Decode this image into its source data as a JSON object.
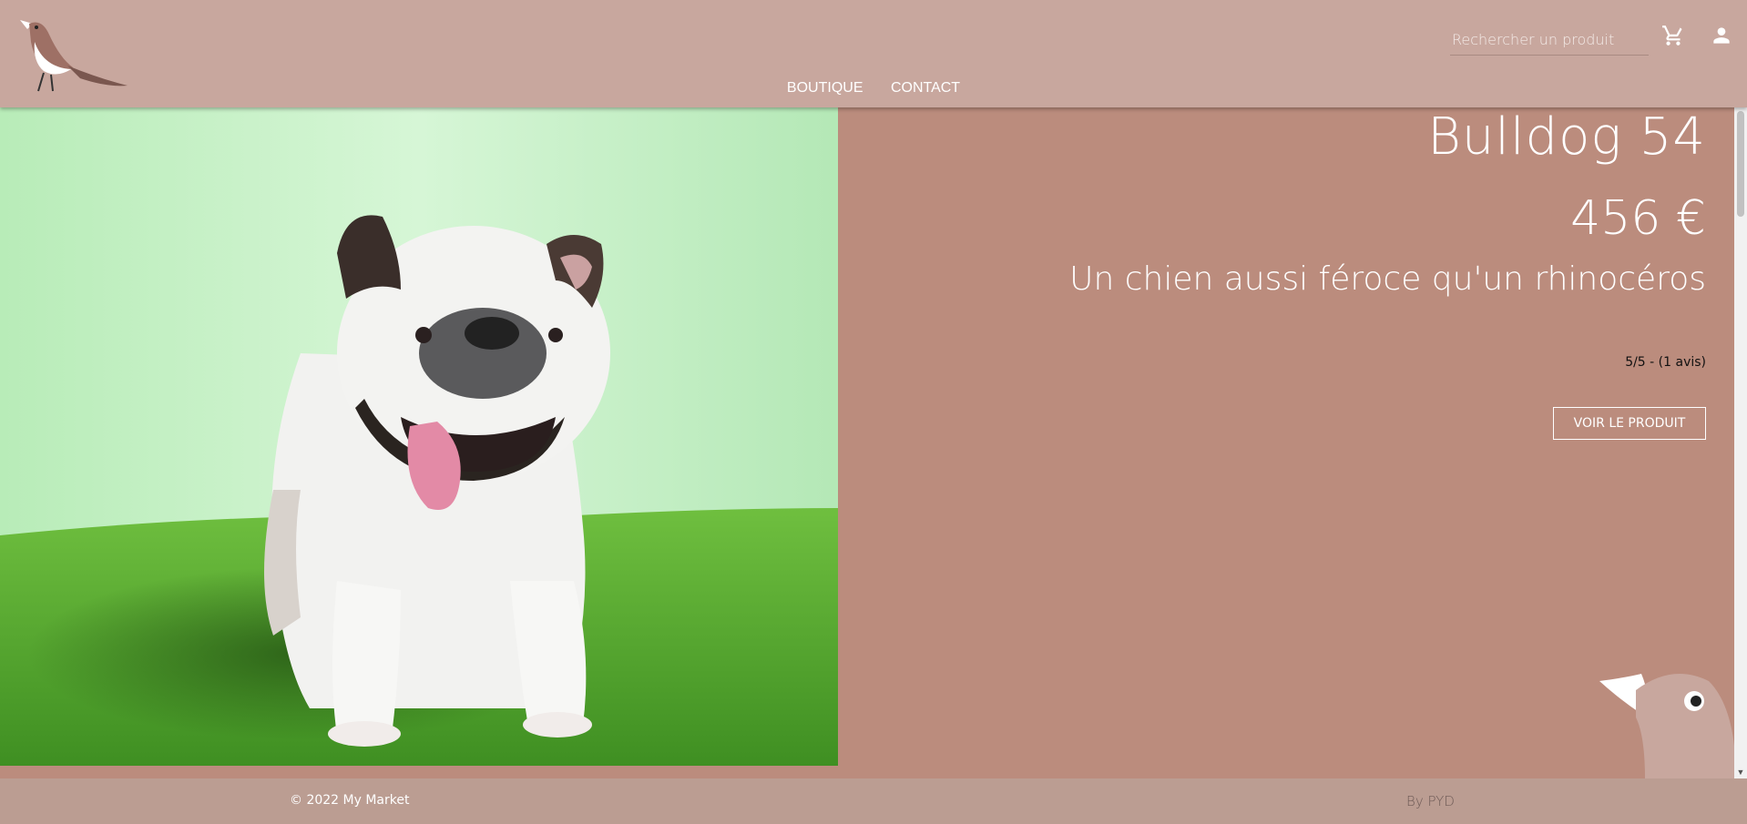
{
  "header": {
    "search": {
      "placeholder": "Rechercher un produit",
      "value": ""
    },
    "nav": [
      "BOUTIQUE",
      "CONTACT"
    ],
    "icons": {
      "cart": "cart-icon",
      "user": "user-icon",
      "logo": "bird-logo"
    }
  },
  "product": {
    "title": "Bulldog 54",
    "price": "456 €",
    "description": "Un chien aussi féroce qu'un rhinocéros",
    "rating": "5/5 - (1 avis)",
    "cta": "VOIR LE PRODUIT",
    "image": "bulldog-photo"
  },
  "footer": {
    "copyright": "© 2022 My Market",
    "author": "By PYD"
  },
  "colors": {
    "header_bg": "#c8a79e",
    "main_bg": "#bb8c7d",
    "footer_bg": "#bb9d92",
    "grass_green": "#5aa537",
    "backdrop_green": "#c8f0c8"
  }
}
